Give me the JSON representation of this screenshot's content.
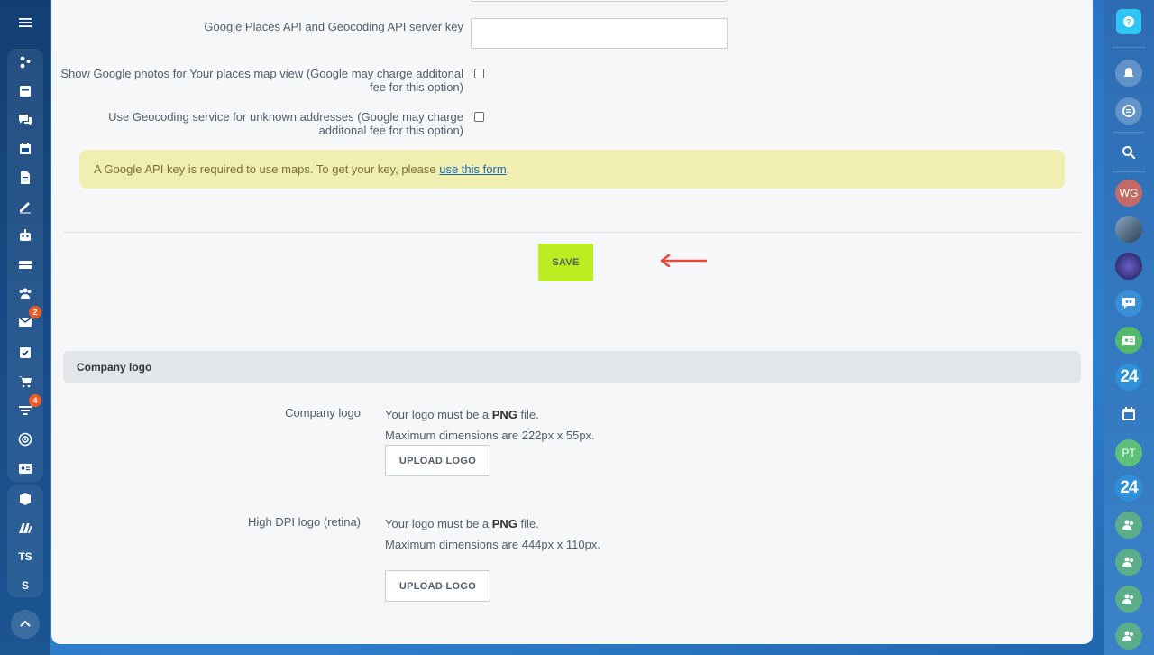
{
  "settings": {
    "places_key_label": "Google Places API and Geocoding API server key",
    "places_key_value": "",
    "photos_label_line1": "Show Google photos for Your places map view (Google may charge additonal",
    "photos_label_line2": "fee for this option)",
    "geocoding_label_line1": "Use Geocoding service for unknown addresses (Google may charge",
    "geocoding_label_line2": "additonal fee for this option)"
  },
  "notice": {
    "text": "A Google API key is required to use maps. To get your key, please ",
    "link": "use this form",
    "suffix": "."
  },
  "save_label": "SAVE",
  "logo_section": {
    "title": "Company logo",
    "company_logo_label": "Company logo",
    "company_logo_line1_pre": "Your logo must be a ",
    "company_logo_format": "PNG",
    "company_logo_line1_post": " file.",
    "company_logo_line2": "Maximum dimensions are 222px x 55px.",
    "company_upload_label": "UPLOAD LOGO",
    "retina_label": "High DPI logo (retina)",
    "retina_line1_pre": "Your logo must be a ",
    "retina_format": "PNG",
    "retina_line1_post": " file.",
    "retina_line2": "Maximum dimensions are 444px x 110px.",
    "retina_upload_label": "UPLOAD LOGO"
  },
  "left_sidebar": {
    "badges": {
      "mail": "2",
      "filter": "4"
    },
    "text_items": [
      "TS",
      "S"
    ]
  },
  "right_sidebar": {
    "avatars": [
      "WG",
      "PT"
    ],
    "counters": [
      "24",
      "24"
    ]
  },
  "colors": {
    "save": "#bbed21",
    "notice_bg": "#f1eeb1",
    "badge": "#f05a28",
    "arrow": "#e8473b"
  }
}
